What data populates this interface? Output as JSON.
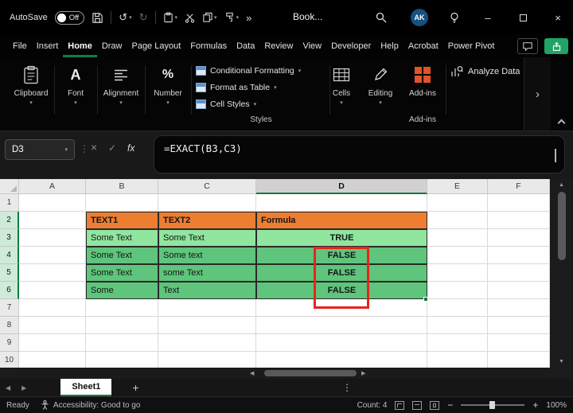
{
  "titlebar": {
    "autosave_label": "AutoSave",
    "autosave_state": "Off",
    "workbook_title": "Book...",
    "avatar_initials": "AK"
  },
  "menubar": {
    "items": [
      "File",
      "Insert",
      "Home",
      "Draw",
      "Page Layout",
      "Formulas",
      "Data",
      "Review",
      "View",
      "Developer",
      "Help",
      "Acrobat",
      "Power Pivot"
    ],
    "active_item": "Home"
  },
  "ribbon": {
    "collapsed_groups": [
      "Clipboard",
      "Font",
      "Alignment",
      "Number"
    ],
    "styles_group": {
      "caption": "Styles",
      "items": [
        "Conditional Formatting",
        "Format as Table",
        "Cell Styles"
      ]
    },
    "cells_label": "Cells",
    "editing_label": "Editing",
    "addins_label": "Add-ins",
    "addins_caption": "Add-ins",
    "analyze_label": "Analyze Data"
  },
  "formula_bar": {
    "name_box": "D3",
    "fx_label": "fx",
    "formula": "=EXACT(B3,C3)"
  },
  "grid": {
    "column_headers": [
      "A",
      "B",
      "C",
      "D",
      "E",
      "F"
    ],
    "selected_column": "D",
    "row_headers": [
      "1",
      "2",
      "3",
      "4",
      "5",
      "6",
      "7",
      "8",
      "9",
      "10"
    ],
    "selected_rows": [
      2,
      3,
      4,
      5,
      6
    ],
    "cells": [
      {
        "ref": "B2",
        "text": "TEXT1",
        "style": "header"
      },
      {
        "ref": "C2",
        "text": "TEXT2",
        "style": "header"
      },
      {
        "ref": "D2",
        "text": "Formula",
        "style": "header"
      },
      {
        "ref": "B3",
        "text": "Some Text",
        "style": "light"
      },
      {
        "ref": "C3",
        "text": "Some Text",
        "style": "light"
      },
      {
        "ref": "D3",
        "text": "TRUE",
        "style": "light center bold"
      },
      {
        "ref": "B4",
        "text": "Some Text",
        "style": "green"
      },
      {
        "ref": "C4",
        "text": "Some text",
        "style": "green"
      },
      {
        "ref": "D4",
        "text": "FALSE",
        "style": "green center bold"
      },
      {
        "ref": "B5",
        "text": "Some Text",
        "style": "green"
      },
      {
        "ref": "C5",
        "text": "some Text",
        "style": "green"
      },
      {
        "ref": "D5",
        "text": "FALSE",
        "style": "green center bold"
      },
      {
        "ref": "B6",
        "text": "Some",
        "style": "green"
      },
      {
        "ref": "C6",
        "text": "Text",
        "style": "green"
      },
      {
        "ref": "D6",
        "text": "FALSE",
        "style": "green center bold"
      }
    ],
    "highlighted_range": "D4:D6"
  },
  "sheet_tabs": {
    "active_tab": "Sheet1"
  },
  "status_bar": {
    "mode": "Ready",
    "accessibility": "Accessibility: Good to go",
    "count": "Count: 4",
    "zoom": "100%"
  },
  "icons": {
    "undo": "↺",
    "redo": "↻",
    "more_commands": "»",
    "dropdown": "▾",
    "dots": "⋮",
    "cancel": "×",
    "confirm": "✓",
    "font_glyph": "A",
    "percent_glyph": "%",
    "scroll_up": "▲",
    "scroll_down": "▼",
    "scroll_left": "◀",
    "scroll_right": "▶",
    "sheet_prev": "◀",
    "sheet_next": "▶",
    "add_sheet": "+",
    "zoom_out": "−",
    "zoom_in": "+",
    "overflow": "›"
  },
  "colors": {
    "accent": "#107C41",
    "share": "#21A366",
    "orange": "#ED7D31",
    "lgreen": "#90E59F",
    "mgreen": "#5FC47C",
    "red": "#E8231B",
    "avatar": "#14527F",
    "addin": "#E25325"
  }
}
